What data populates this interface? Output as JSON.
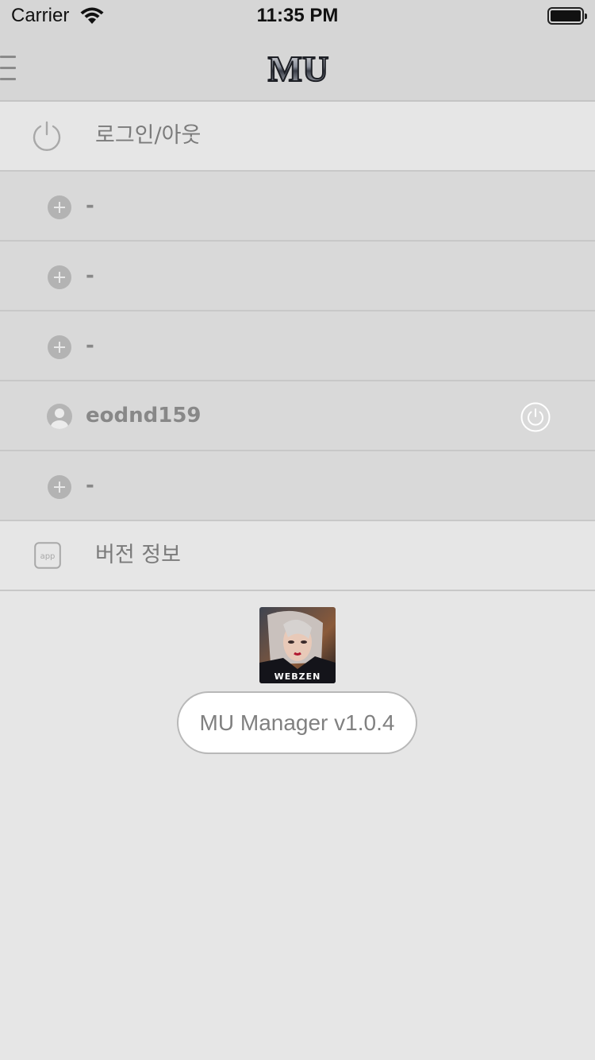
{
  "status_bar": {
    "carrier": "Carrier",
    "time": "11:35 PM"
  },
  "nav": {
    "logo_text": "MU",
    "menu_icon": "hamburger-icon"
  },
  "menu": {
    "login_logout": "로그인/아웃",
    "accounts": [
      "-",
      "-",
      "-",
      "eodnd159",
      "-"
    ],
    "version_info": "버전 정보"
  },
  "footer": {
    "app_icon_brand": "WEBZEN",
    "version_label": "MU Manager v1.0.4"
  },
  "colors": {
    "background": "#e6e6e6",
    "bar_background": "#d6d6d6",
    "account_row_background": "#d9d9d9",
    "text": "#7a7a7a"
  }
}
